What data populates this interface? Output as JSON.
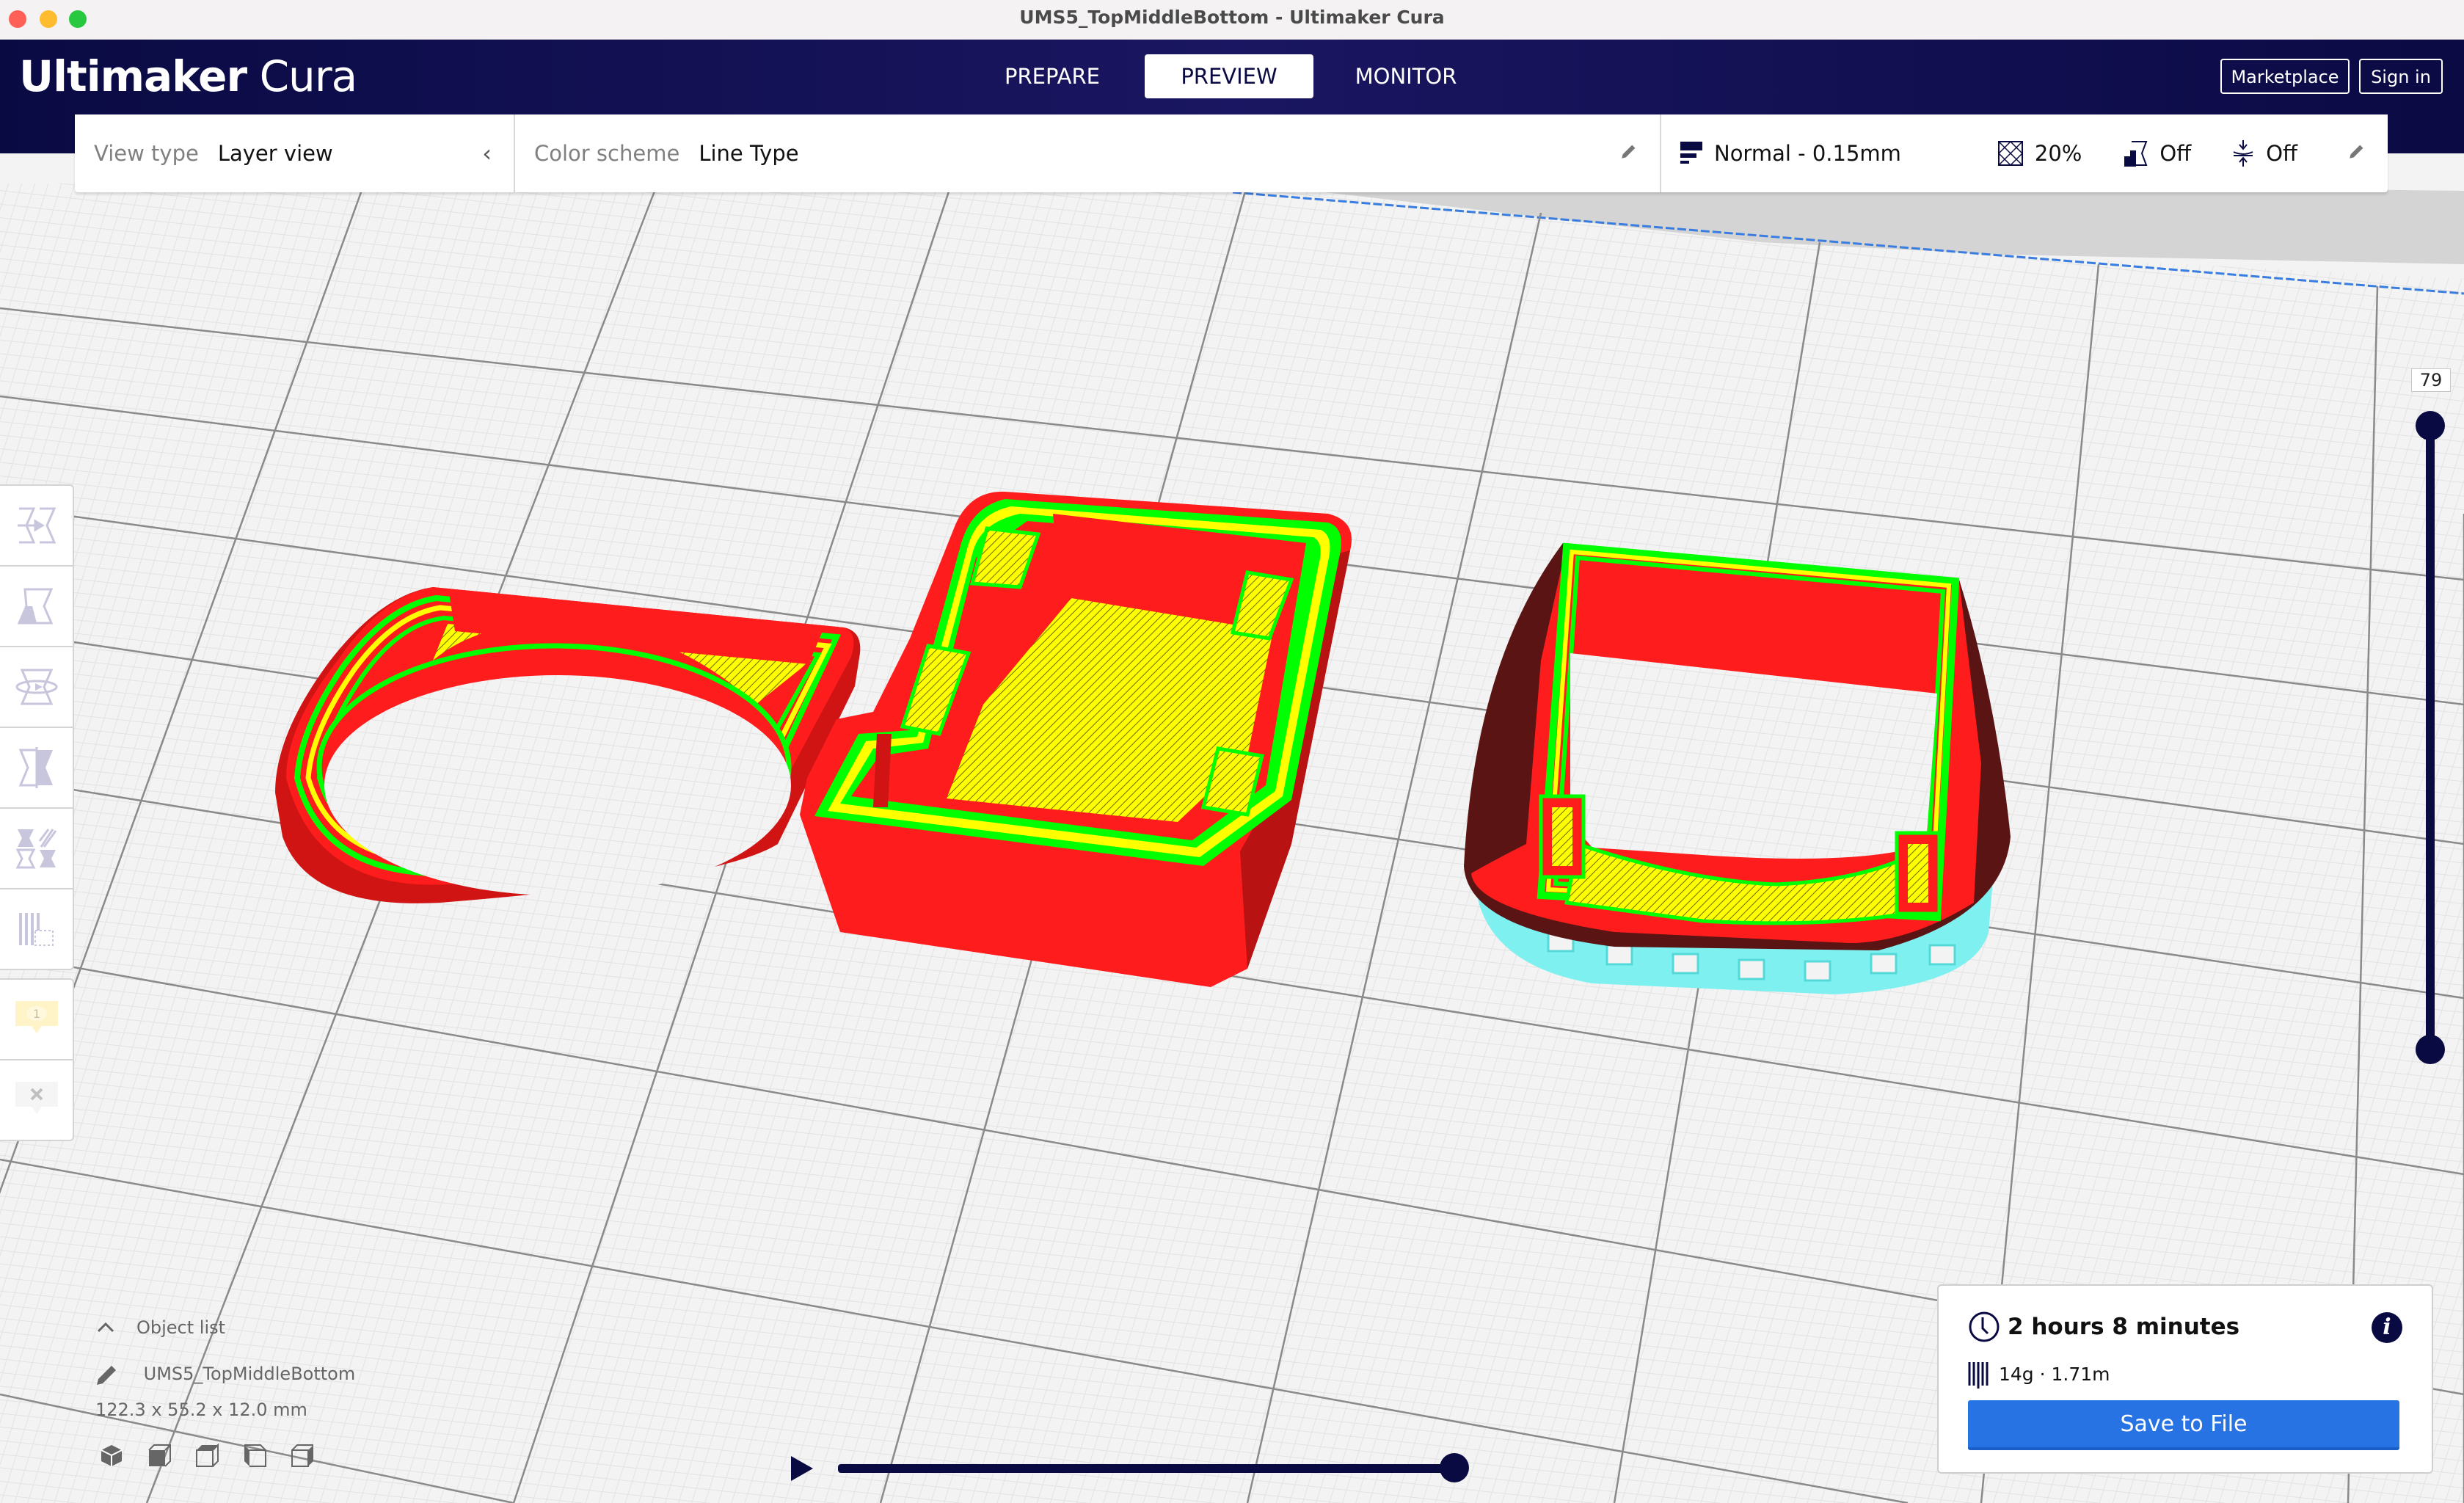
{
  "window": {
    "title": "UMS5_TopMiddleBottom - Ultimaker Cura"
  },
  "header": {
    "logo_bold": "Ultimaker",
    "logo_light": "Cura",
    "stages": [
      {
        "label": "PREPARE",
        "active": false
      },
      {
        "label": "PREVIEW",
        "active": true
      },
      {
        "label": "MONITOR",
        "active": false
      }
    ],
    "marketplace_label": "Marketplace",
    "signin_label": "Sign in"
  },
  "toolbar": {
    "view_type_label": "View type",
    "view_type_value": "Layer view",
    "color_scheme_label": "Color scheme",
    "color_scheme_value": "Line Type",
    "profile": "Normal - 0.15mm",
    "infill": "20%",
    "support": "Off",
    "adhesion": "Off"
  },
  "left_tools": [
    {
      "name": "move-tool",
      "icon": "move-icon"
    },
    {
      "name": "scale-tool",
      "icon": "scale-icon"
    },
    {
      "name": "rotate-tool",
      "icon": "rotate-icon"
    },
    {
      "name": "mirror-tool",
      "icon": "mirror-icon"
    },
    {
      "name": "per-model-settings-tool",
      "icon": "per-model-settings-icon"
    },
    {
      "name": "support-blocker-tool",
      "icon": "support-blocker-icon"
    }
  ],
  "extruder": {
    "number": "1"
  },
  "layer_slider": {
    "current_layer": "79",
    "min_fraction": 0.0,
    "max_fraction": 1.0
  },
  "path_slider": {
    "position_fraction": 1.0
  },
  "object_list": {
    "heading": "Object list",
    "name": "UMS5_TopMiddleBottom",
    "dimensions": "122.3 x 55.2 x 12.0 mm",
    "camera_views": [
      "3d-view",
      "front-view",
      "top-view",
      "left-view",
      "right-view"
    ]
  },
  "print_info": {
    "time": "2 hours 8 minutes",
    "material": "14g · 1.71m",
    "save_label": "Save to File"
  },
  "colors": {
    "brand_navy": "#0a0a43",
    "accent_blue": "#2873e3",
    "wall_outer": "#ff1c1c",
    "wall_inner": "#00ff00",
    "skin": "#ffff00",
    "support": "#7ff0f0"
  }
}
